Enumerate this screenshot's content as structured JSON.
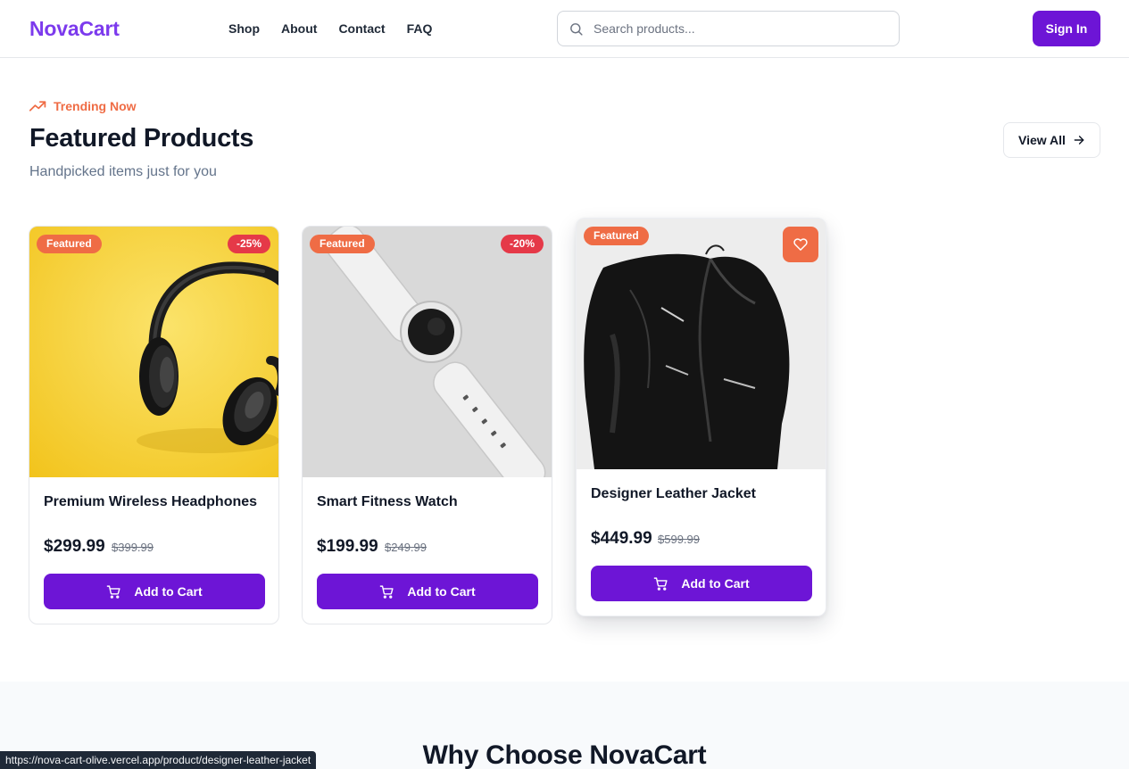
{
  "header": {
    "logo": "NovaCart",
    "nav": [
      "Shop",
      "About",
      "Contact",
      "FAQ"
    ],
    "search_placeholder": "Search products...",
    "sign_in": "Sign In"
  },
  "section": {
    "eyebrow": "Trending Now",
    "title": "Featured Products",
    "subtitle": "Handpicked items just for you",
    "view_all": "View All"
  },
  "products": [
    {
      "name": "Premium Wireless Headphones",
      "price": "$299.99",
      "old_price": "$399.99",
      "badge": "Featured",
      "discount": "-25%",
      "cta": "Add to Cart",
      "image_bg": "#f6d33c"
    },
    {
      "name": "Smart Fitness Watch",
      "price": "$199.99",
      "old_price": "$249.99",
      "badge": "Featured",
      "discount": "-20%",
      "cta": "Add to Cart",
      "image_bg": "#d9d9d9"
    },
    {
      "name": "Designer Leather Jacket",
      "price": "$449.99",
      "old_price": "$599.99",
      "badge": "Featured",
      "discount": "",
      "cta": "Add to Cart",
      "image_bg": "#e6e6e6"
    }
  ],
  "why": {
    "title": "Why Choose NovaCart"
  },
  "status_bar": {
    "url": "https://nova-cart-olive.vercel.app/product/designer-leather-jacket"
  },
  "colors": {
    "brand": "#7c3aed",
    "button": "#6d15d6",
    "accent": "#ef6c45",
    "discount": "#e53948"
  },
  "icons": {
    "search": "search-icon",
    "trend": "trending-up-icon",
    "arrow": "arrow-right-icon",
    "cart": "shopping-cart-icon",
    "favorite": "heart-icon"
  }
}
